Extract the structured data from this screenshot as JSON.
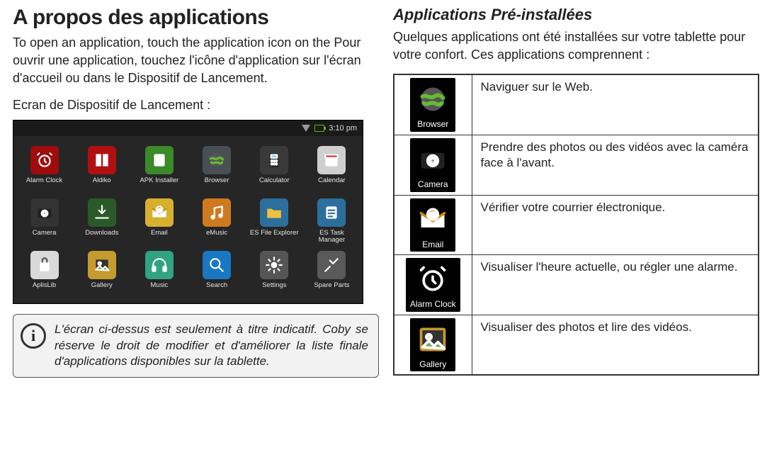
{
  "left": {
    "heading": "A propos des applications",
    "intro": "To open an application, touch the application icon on the Pour ouvrir une application, touchez l'icône d'application sur l'écran d'accueil ou dans le Dispositif de Lancement.",
    "launcher_caption": "Ecran de Dispositif de Lancement :",
    "status_time": "3:10 pm",
    "apps": [
      {
        "label": "Alarm Clock",
        "icon": "alarm-clock-icon",
        "bg": "#a00b0b"
      },
      {
        "label": "Aldiko",
        "icon": "book-icon",
        "bg": "#b01010"
      },
      {
        "label": "APK Installer",
        "icon": "apk-icon",
        "bg": "#3a8a2a"
      },
      {
        "label": "Browser",
        "icon": "globe-icon",
        "bg": "#4a4f55"
      },
      {
        "label": "Calculator",
        "icon": "calculator-icon",
        "bg": "#3a3a3a"
      },
      {
        "label": "Calendar",
        "icon": "calendar-icon",
        "bg": "#cfcfcf"
      },
      {
        "label": "Camera",
        "icon": "camera-icon",
        "bg": "#333"
      },
      {
        "label": "Downloads",
        "icon": "downloads-icon",
        "bg": "#2a5a2a"
      },
      {
        "label": "Email",
        "icon": "email-icon",
        "bg": "#d8b030"
      },
      {
        "label": "eMusic",
        "icon": "music-note-icon",
        "bg": "#d07a20"
      },
      {
        "label": "ES File Explorer",
        "icon": "folder-icon",
        "bg": "#2c6f9c"
      },
      {
        "label": "ES Task\nManager",
        "icon": "task-icon",
        "bg": "#2c6f9c"
      },
      {
        "label": "AplisLib",
        "icon": "bag-icon",
        "bg": "#d9d9d9"
      },
      {
        "label": "Gallery",
        "icon": "gallery-icon",
        "bg": "#c59a2f"
      },
      {
        "label": "Music",
        "icon": "headphones-icon",
        "bg": "#2fa382"
      },
      {
        "label": "Search",
        "icon": "search-icon",
        "bg": "#1a78c2"
      },
      {
        "label": "Settings",
        "icon": "gear-icon",
        "bg": "#555"
      },
      {
        "label": "Spare Parts",
        "icon": "tools-icon",
        "bg": "#5a5a5a"
      }
    ],
    "info_note": "L'écran ci-dessus est seulement à titre indicatif. Coby se réserve le droit de modifier et d'améliorer la liste finale d'applications disponibles sur la tablette."
  },
  "right": {
    "heading": "Applications Pré-installées",
    "intro": "Quelques applications ont été installées sur votre tablette pour votre confort. Ces applications comprennent :",
    "rows": [
      {
        "icon": "globe-icon",
        "label": "Browser",
        "desc": "Naviguer sur le Web."
      },
      {
        "icon": "camera-icon",
        "label": "Camera",
        "desc": "Prendre des photos ou des vidéos avec la caméra face à l'avant."
      },
      {
        "icon": "email-icon",
        "label": "Email",
        "desc": "Vérifier votre courrier électronique."
      },
      {
        "icon": "alarm-clock-icon",
        "label": "Alarm Clock",
        "desc": "Visualiser l'heure actuelle, ou régler une alarme."
      },
      {
        "icon": "gallery-icon",
        "label": "Gallery",
        "desc": "Visualiser des photos et lire des vidéos."
      }
    ]
  }
}
